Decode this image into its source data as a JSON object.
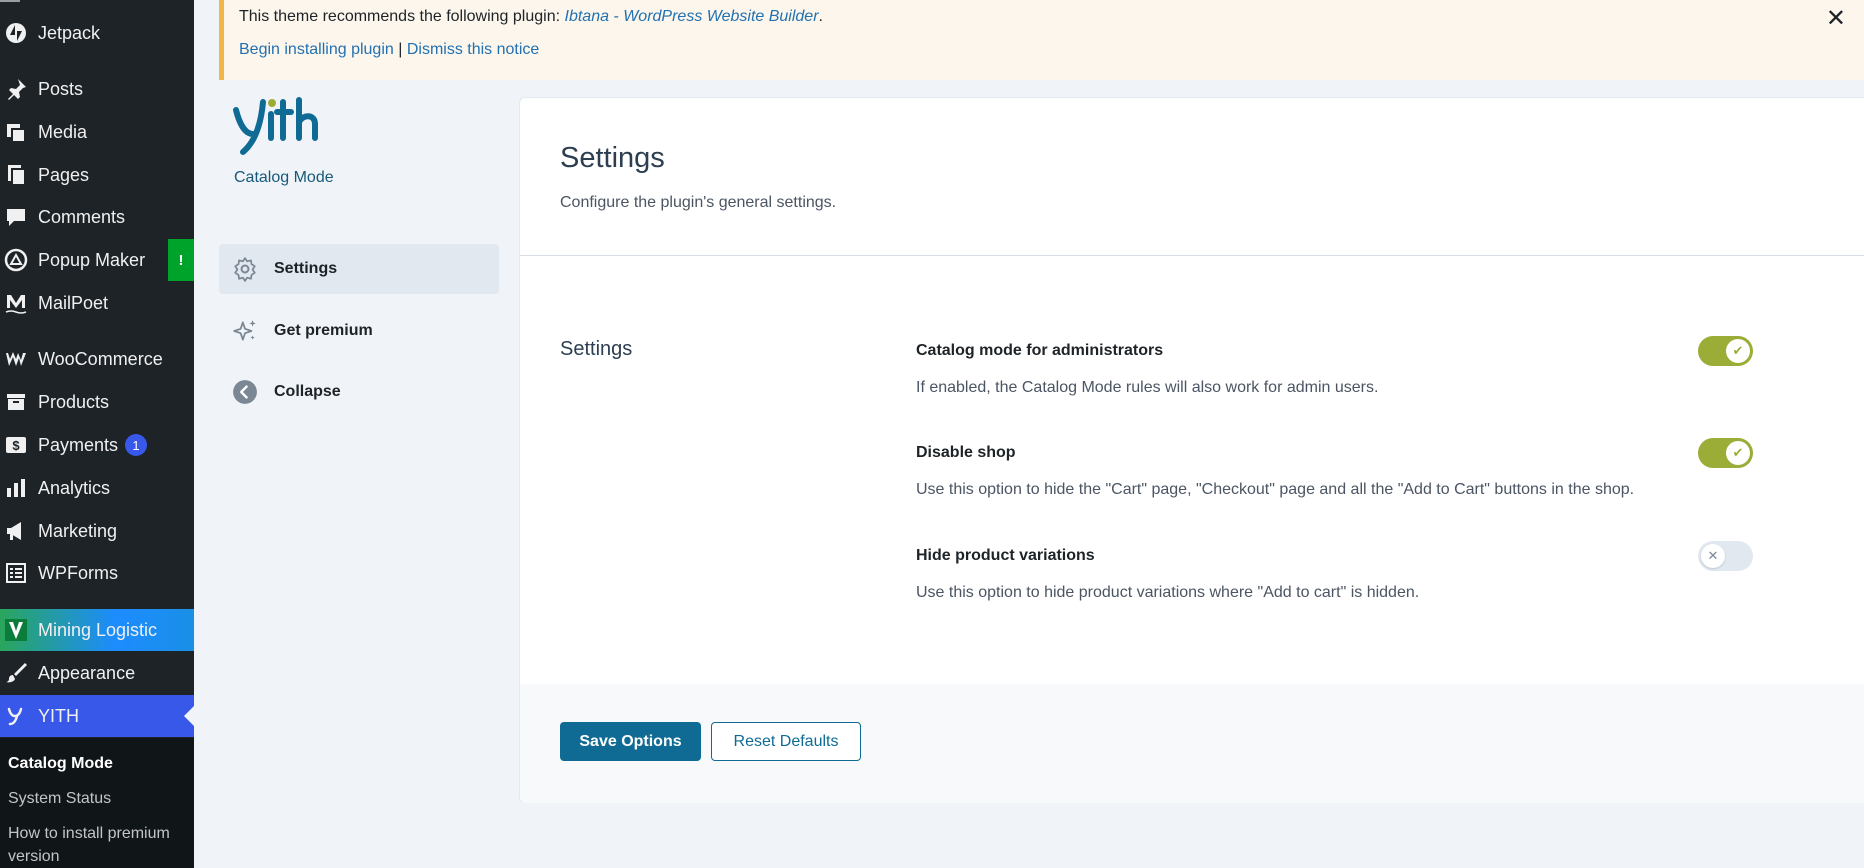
{
  "admin_menu": {
    "items": [
      {
        "label": "Jetpack",
        "icon": "jetpack-icon"
      },
      {
        "label": "Posts",
        "icon": "pushpin-icon"
      },
      {
        "label": "Media",
        "icon": "media-icon"
      },
      {
        "label": "Pages",
        "icon": "pages-icon"
      },
      {
        "label": "Comments",
        "icon": "comment-icon"
      },
      {
        "label": "Popup Maker",
        "icon": "popup-maker-icon",
        "alert": "!"
      },
      {
        "label": "MailPoet",
        "icon": "mailpoet-icon"
      },
      {
        "label": "WooCommerce",
        "icon": "woocommerce-icon"
      },
      {
        "label": "Products",
        "icon": "archive-icon"
      },
      {
        "label": "Payments",
        "icon": "dollar-icon",
        "badge": "1"
      },
      {
        "label": "Analytics",
        "icon": "bar-chart-icon"
      },
      {
        "label": "Marketing",
        "icon": "megaphone-icon"
      },
      {
        "label": "WPForms",
        "icon": "form-icon"
      },
      {
        "label": "Mining Logistic",
        "icon": "v-logo-icon"
      },
      {
        "label": "Appearance",
        "icon": "paintbrush-icon"
      },
      {
        "label": "YITH",
        "icon": "yith-icon"
      }
    ],
    "submenu": [
      {
        "label": "Catalog Mode"
      },
      {
        "label": "System Status"
      },
      {
        "label": "How to install premium version"
      }
    ]
  },
  "notice": {
    "text_prefix": "This theme recommends the following plugin:",
    "plugin_link": "Ibtana - WordPress Website Builder",
    "suffix": ".",
    "begin_link": "Begin installing plugin",
    "separator": "|",
    "dismiss_link": "Dismiss this notice",
    "close_symbol": "✕"
  },
  "plugin": {
    "name": "Catalog Mode",
    "nav": [
      {
        "label": "Settings",
        "icon": "gear-icon"
      },
      {
        "label": "Get premium",
        "icon": "sparkle-icon"
      },
      {
        "label": "Collapse",
        "icon": "arrow-left-circle-icon"
      }
    ]
  },
  "page": {
    "title": "Settings",
    "description": "Configure the plugin's general settings.",
    "section_title": "Settings",
    "options": [
      {
        "label": "Catalog mode for administrators",
        "description": "If enabled, the Catalog Mode rules will also work for admin users.",
        "enabled": true
      },
      {
        "label": "Disable shop",
        "description": "Use this option to hide the \"Cart\" page, \"Checkout\" page and all the \"Add to Cart\" buttons in the shop.",
        "enabled": true
      },
      {
        "label": "Hide product variations",
        "description": "Use this option to hide product variations where \"Add to cart\" is hidden.",
        "enabled": false
      }
    ],
    "save_label": "Save Options",
    "reset_label": "Reset Defaults"
  },
  "colors": {
    "admin_bg": "#1d2327",
    "accent_blue": "#3858e9",
    "toggle_on": "#9bac37",
    "primary_button": "#0f6b94",
    "notice_border": "#f0b849"
  }
}
